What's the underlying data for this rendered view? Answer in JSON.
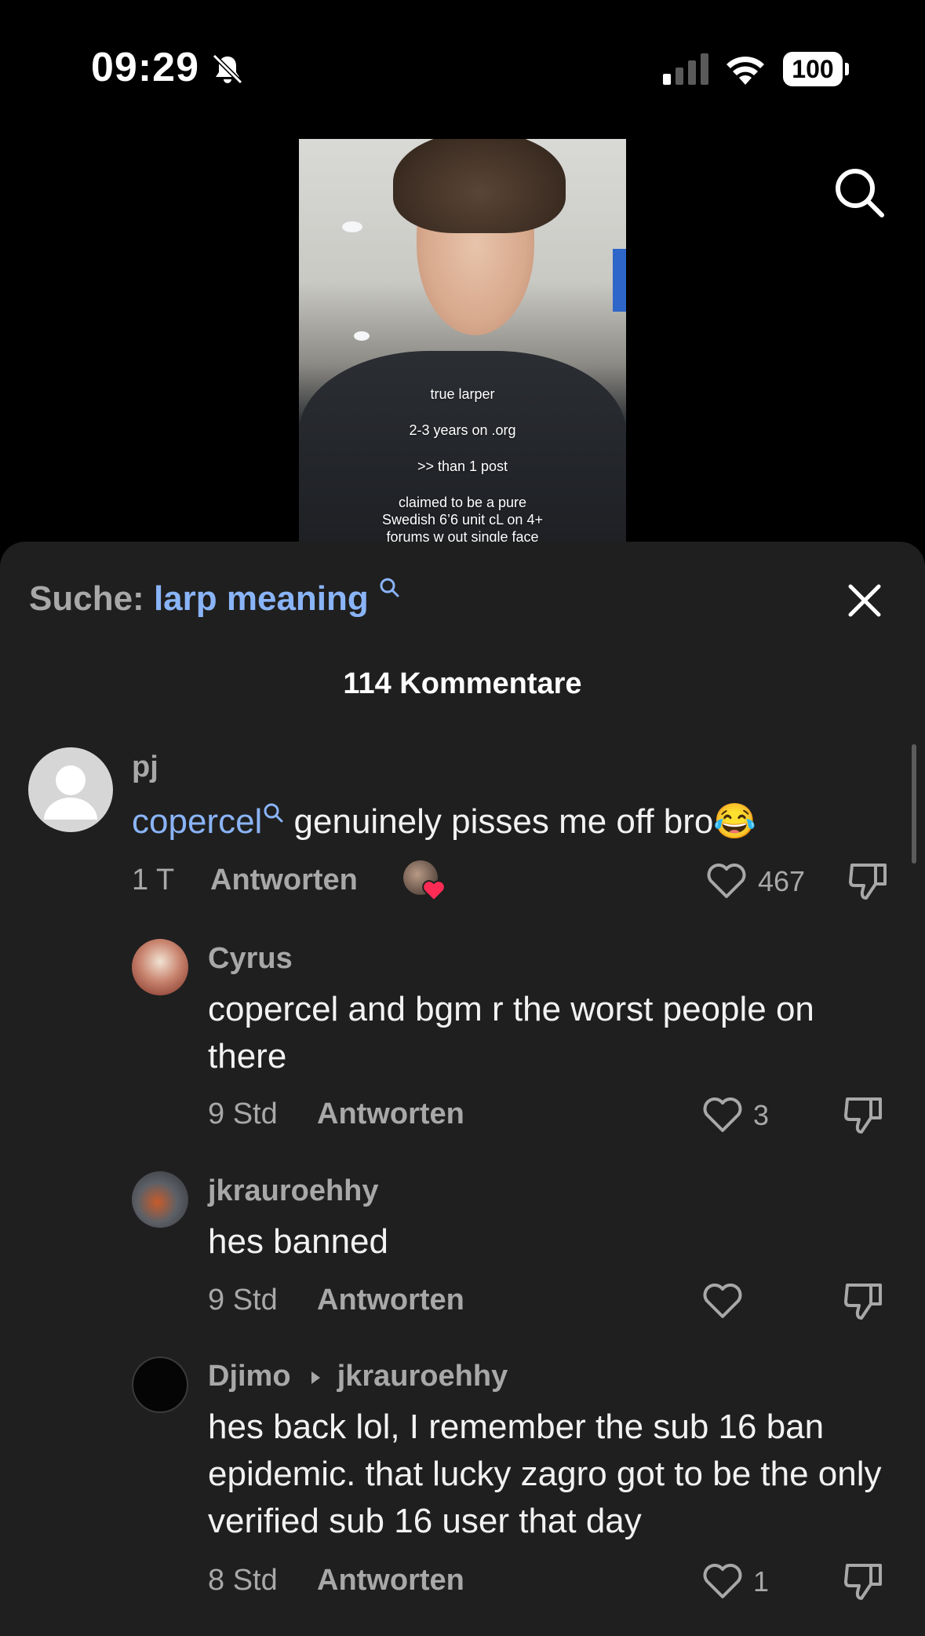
{
  "status": {
    "time": "09:29",
    "battery": "100"
  },
  "video": {
    "overlay_lines": [
      "true larper",
      "2-3 years on .org",
      ">> than 1 post",
      "claimed to be a pure",
      "Swedish 6’6 unit cL on 4+",
      "forums w out single face"
    ]
  },
  "sheet": {
    "search_label": "Suche:",
    "search_term": "larp meaning",
    "comment_count": "114 Kommentare"
  },
  "comments": [
    {
      "user": "pj",
      "mention": "copercel",
      "text": " genuinely pisses me off bro😂",
      "time": "1 T",
      "reply": "Antworten",
      "likes": "467"
    },
    {
      "user": "Cyrus",
      "text": "copercel and bgm r the worst people on there",
      "time": "9 Std",
      "reply": "Antworten",
      "likes": "3"
    },
    {
      "user": "jkrauroehhy",
      "text": "hes banned",
      "time": "9 Std",
      "reply": "Antworten",
      "likes": ""
    },
    {
      "user": "Djimo",
      "reply_to": "jkrauroehhy",
      "text": "hes back lol, I remember the sub 16 ban epidemic. that lucky zagro got to be the only verified sub 16 user that day",
      "time": "8 Std",
      "reply": "Antworten",
      "likes": "1"
    }
  ],
  "icons": {
    "bell": "bell-muted-icon",
    "search": "search-icon",
    "close": "close-icon",
    "like": "heart-outline-icon",
    "dislike": "thumbs-down-icon"
  },
  "colors": {
    "accent": "#8ab4f8",
    "sheet_bg": "#1f1f1f",
    "muted": "#a8a8a8",
    "heart": "#fe2c55"
  }
}
